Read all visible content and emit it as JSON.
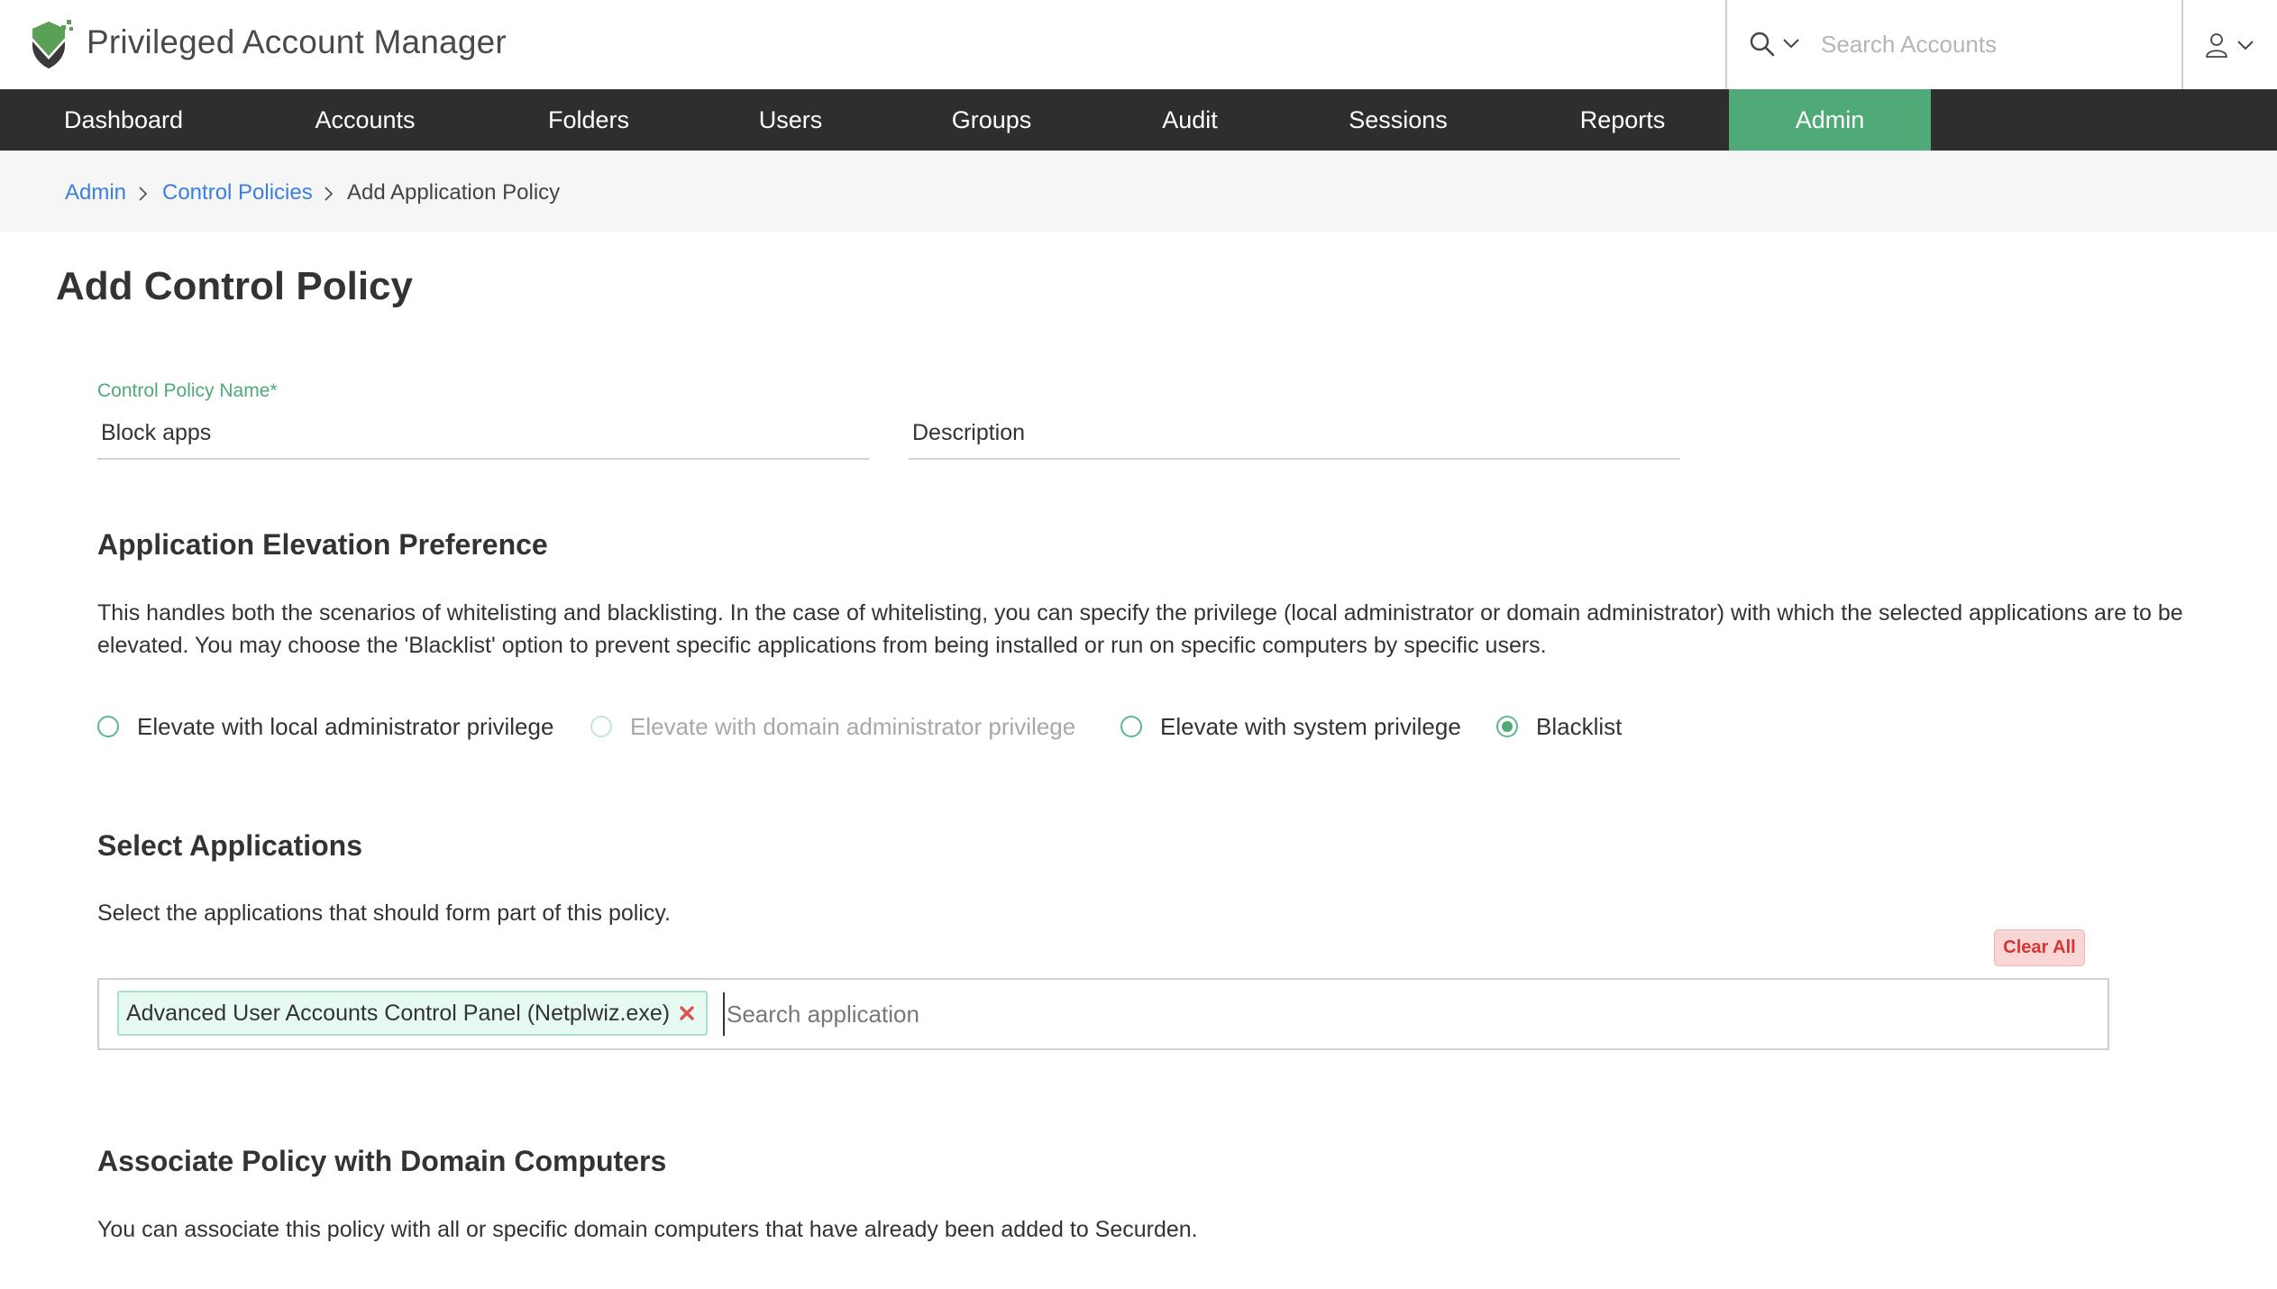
{
  "header": {
    "app_title": "Privileged Account Manager",
    "logo_icon": "shield-check-logo",
    "search_placeholder": "Search Accounts",
    "search_icon": "search-icon",
    "user_icon": "user-icon"
  },
  "nav": {
    "items": [
      {
        "label": "Dashboard",
        "active": false
      },
      {
        "label": "Accounts",
        "active": false
      },
      {
        "label": "Folders",
        "active": false
      },
      {
        "label": "Users",
        "active": false
      },
      {
        "label": "Groups",
        "active": false
      },
      {
        "label": "Audit",
        "active": false
      },
      {
        "label": "Sessions",
        "active": false
      },
      {
        "label": "Reports",
        "active": false
      },
      {
        "label": "Admin",
        "active": true
      }
    ]
  },
  "breadcrumb": {
    "items": [
      "Admin",
      "Control Policies",
      "Add Application Policy"
    ]
  },
  "page": {
    "title": "Add Control Policy"
  },
  "form": {
    "name_label": "Control Policy Name*",
    "name_value": "Block apps",
    "description_placeholder": "Description",
    "description_value": ""
  },
  "elevation": {
    "title": "Application Elevation Preference",
    "description": "This handles both the scenarios of whitelisting and blacklisting. In the case of whitelisting, you can specify the privilege (local administrator or domain administrator) with which the selected applications are to be elevated. You may choose the 'Blacklist' option to prevent specific applications from being installed or run on specific computers by specific users.",
    "options": [
      {
        "label": "Elevate with local administrator privilege",
        "checked": false,
        "disabled": false
      },
      {
        "label": "Elevate with domain administrator privilege",
        "checked": false,
        "disabled": true
      },
      {
        "label": "Elevate with system privilege",
        "checked": false,
        "disabled": false
      },
      {
        "label": "Blacklist",
        "checked": true,
        "disabled": false
      }
    ]
  },
  "applications": {
    "title": "Select Applications",
    "description": "Select the applications that should form part of this policy.",
    "clear_all_label": "Clear All",
    "selected": [
      "Advanced User Accounts Control Panel (Netplwiz.exe)"
    ],
    "search_placeholder": "Search application"
  },
  "domain_computers": {
    "title": "Associate Policy with Domain Computers",
    "description": "You can associate this policy with all or specific domain computers that have already been added to Securden."
  },
  "colors": {
    "accent": "#4faa78",
    "nav_bg": "#2e2e2e",
    "link": "#3a7fe0",
    "danger": "#d63535"
  }
}
